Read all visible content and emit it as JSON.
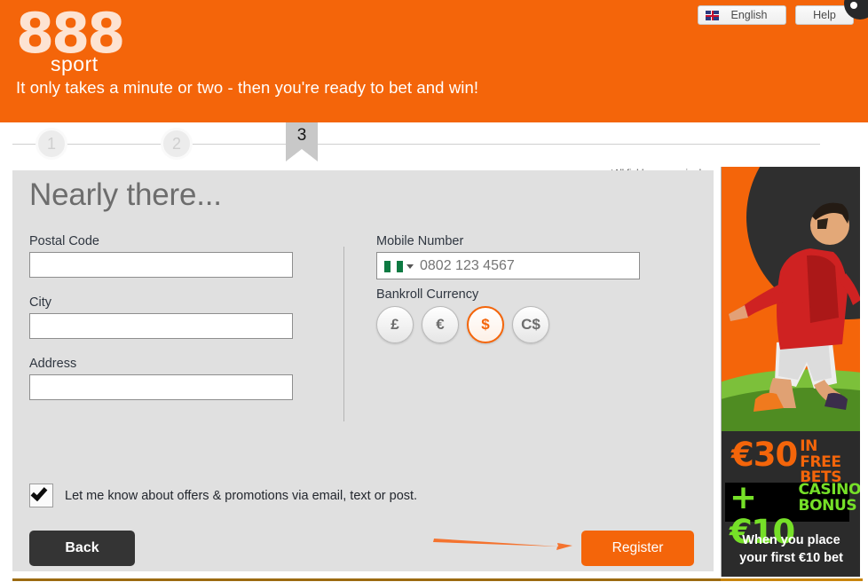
{
  "header": {
    "brand_main": "888",
    "brand_sub": "sport",
    "tagline": "It only takes a minute or two - then you're ready to bet and win!",
    "lang_button": "English",
    "help_button": "Help",
    "lang_icon": "uk-flag-icon",
    "accent_color": "#f4650a"
  },
  "stepper": {
    "steps": [
      {
        "label": "1",
        "state": "completed"
      },
      {
        "label": "2",
        "state": "completed"
      },
      {
        "label": "3",
        "state": "active"
      }
    ]
  },
  "form": {
    "required_note": "*All fields are required.",
    "title": "Nearly there...",
    "postal_code": {
      "label": "Postal Code",
      "value": "",
      "placeholder": ""
    },
    "city": {
      "label": "City",
      "value": "",
      "placeholder": ""
    },
    "address": {
      "label": "Address",
      "value": "",
      "placeholder": ""
    },
    "mobile": {
      "label": "Mobile Number",
      "value": "",
      "placeholder": "0802 123 4567",
      "country_flag": "nigeria-flag-icon"
    },
    "bankroll": {
      "label": "Bankroll Currency",
      "options": [
        "£",
        "€",
        "$",
        "C$"
      ],
      "selected": "$",
      "selected_color": "#f4650a"
    },
    "promo_optin": {
      "label": "Let me know about offers & promotions via email, text or post.",
      "checked": true
    },
    "back_button": "Back",
    "register_button": "Register"
  },
  "annotation": {
    "arrow_target": "Register",
    "arrow_color": "#f4732f"
  },
  "promo_banner": {
    "free_bets_amount": "€30",
    "free_bets_line1": "IN FREE",
    "free_bets_line2": "BETS",
    "casino_amount": "+€10",
    "casino_line1": "CASINO",
    "casino_line2": "BONUS",
    "subtext_line1": "When you place",
    "subtext_line2": "your first €10 bet",
    "amount_color": "#f4650a",
    "bonus_color": "#76e028"
  }
}
